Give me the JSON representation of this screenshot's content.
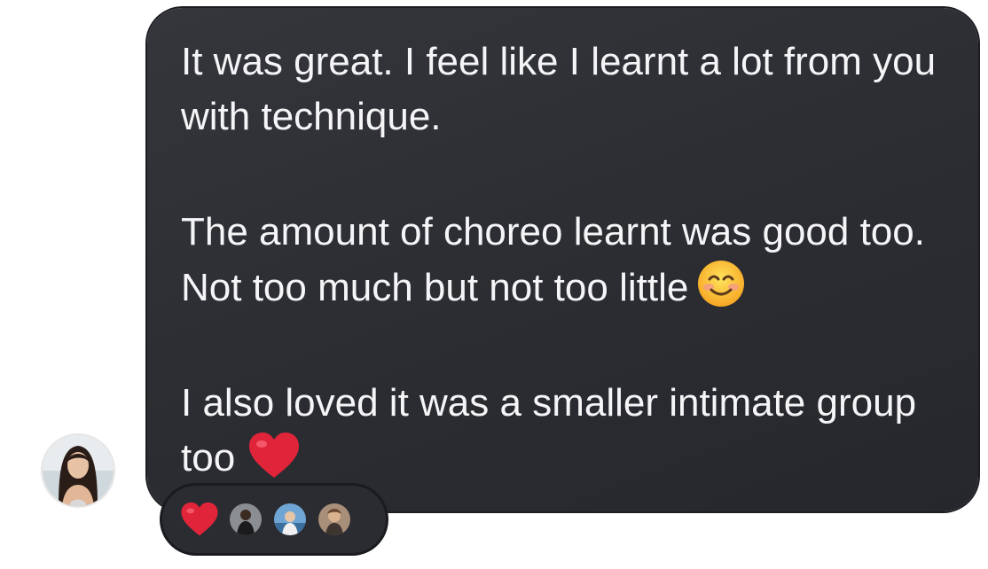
{
  "message": {
    "paragraphs": [
      "It was great. I feel like I learnt a lot from you with technique.",
      "The amount of choreo learnt was good too. Not too much but not too little",
      "I also loved it was a smaller intimate group too"
    ],
    "paragraph_2_emoji": "smiling-face-emoji",
    "paragraph_3_emoji": "red-heart-emoji"
  },
  "reactions": {
    "emoji": "red-heart",
    "reactor_count": 3
  },
  "colors": {
    "bubble": "#2e3035",
    "text": "#f5f5f7",
    "heart": "#e0243a"
  }
}
